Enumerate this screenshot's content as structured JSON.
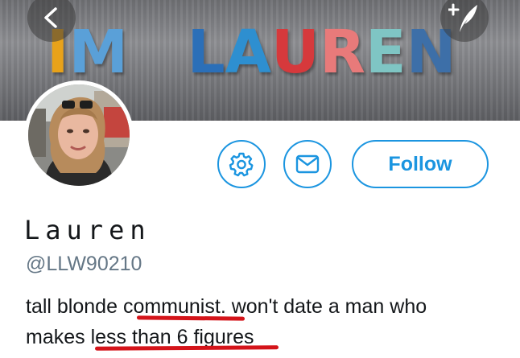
{
  "banner": {
    "letters": [
      {
        "char": "I",
        "color": "#e8a21a"
      },
      {
        "char": "M",
        "color": "#5aa0d8"
      },
      {
        "char": " ",
        "color": "#ffffff"
      },
      {
        "char": "L",
        "color": "#2b6fb8"
      },
      {
        "char": "A",
        "color": "#2e8fd0"
      },
      {
        "char": "U",
        "color": "#d6393c"
      },
      {
        "char": "R",
        "color": "#e87a7a"
      },
      {
        "char": "E",
        "color": "#7fc5c4"
      },
      {
        "char": "N",
        "color": "#3d6fa8"
      }
    ]
  },
  "nav": {
    "back_icon": "back-arrow-icon",
    "compose_icon": "compose-tweet-icon"
  },
  "profile": {
    "display_name": "Lauren",
    "handle": "@LLW90210",
    "bio": {
      "part1": "tall blonde ",
      "highlight1": "communist",
      "part2": ". won't date a man who",
      "part3": "makes ",
      "highlight2": "less than 6 figures"
    }
  },
  "actions": {
    "settings_icon": "gear-icon",
    "message_icon": "envelope-icon",
    "follow_label": "Follow"
  },
  "colors": {
    "accent": "#1b95e0",
    "underline": "#d4141a",
    "handle_gray": "#657786",
    "text": "#14171a"
  }
}
